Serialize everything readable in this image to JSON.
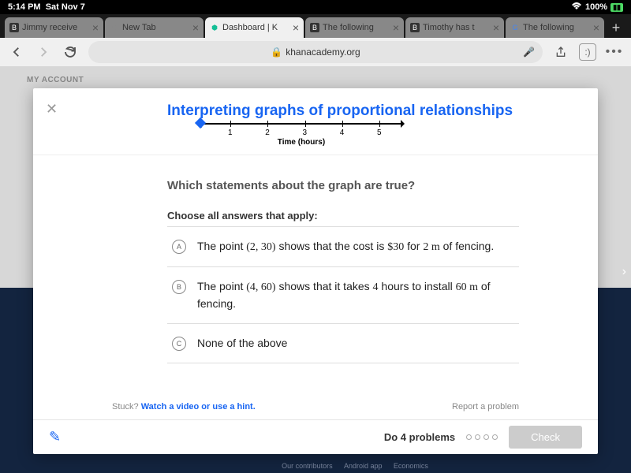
{
  "status": {
    "time": "5:14 PM",
    "date": "Sat Nov 7",
    "battery": "100%"
  },
  "tabs": [
    {
      "label": "Jimmy receive"
    },
    {
      "label": "New Tab"
    },
    {
      "label": "Dashboard | K"
    },
    {
      "label": "The following"
    },
    {
      "label": "Timothy has t"
    },
    {
      "label": "The following"
    }
  ],
  "url": "khanacademy.org",
  "sidebar_label": "MY ACCOUNT",
  "modal": {
    "title": "Interpreting graphs of proportional relationships",
    "axis_ticks": [
      "1",
      "2",
      "3",
      "4",
      "5"
    ],
    "axis_label": "Time (hours)",
    "question": "Which statements about the graph are true?",
    "instruction": "Choose all answers that apply:",
    "answers": [
      {
        "letter": "A",
        "text_html": "The point <span class='math'>(2, 30)</span> shows that the cost is <span class='math'>$30</span> for <span class='math'>2 m</span> of fencing."
      },
      {
        "letter": "B",
        "text_html": "The point <span class='math'>(4, 60)</span> shows that it takes <span class='math'>4</span> hours to install <span class='math'>60 m</span> of fencing."
      },
      {
        "letter": "C",
        "text_html": "None of the above"
      }
    ],
    "stuck_label": "Stuck?",
    "stuck_link": "Watch a video or use a hint.",
    "report": "Report a problem",
    "do_problems": "Do 4 problems",
    "check": "Check"
  },
  "footer": {
    "a": "Our contributors",
    "b": "Android app",
    "c": "Economics"
  }
}
